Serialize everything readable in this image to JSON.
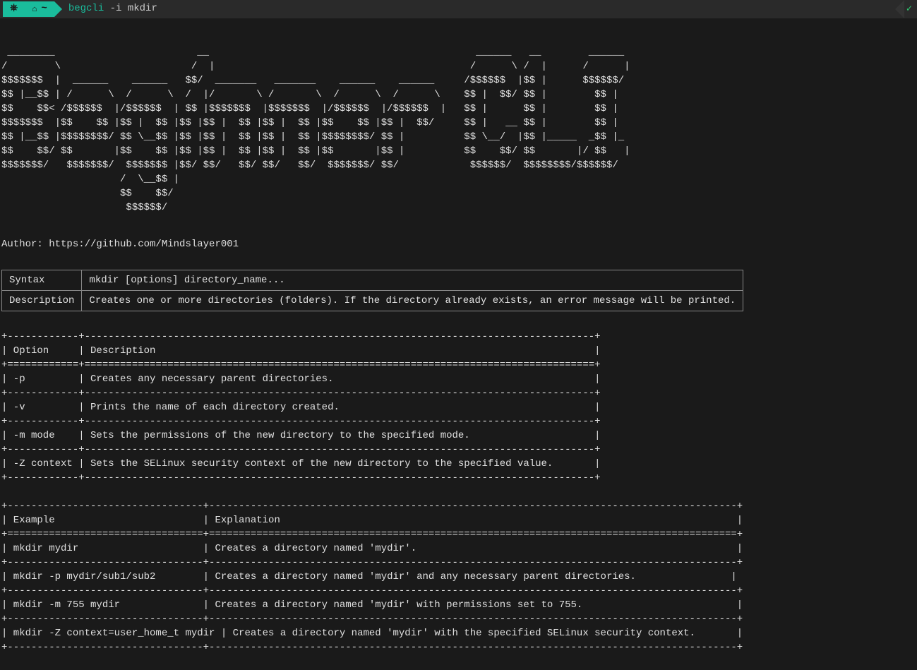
{
  "titlebar": {
    "logo": "⎈",
    "home_icon": "⌂",
    "tilde": "~",
    "cmd_name": "begcli",
    "cmd_args": "-i mkdir",
    "status_check": "✓"
  },
  "ascii_art": " ________                        __                                             ______   __        ______\n/        \\                      /  |                                           /      \\ /  |      /      |\n$$$$$$$  |  ______    ______   $$/  _______   _______    ______    ______     /$$$$$$  |$$ |      $$$$$$/\n$$ |__$$ | /      \\  /      \\  /  |/       \\ /       \\  /      \\  /      \\    $$ |  $$/ $$ |        $$ |\n$$    $$< /$$$$$$  |/$$$$$$  | $$ |$$$$$$$  |$$$$$$$  |/$$$$$$  |/$$$$$$  |   $$ |      $$ |        $$ |\n$$$$$$$  |$$    $$ |$$ |  $$ |$$ |$$ |  $$ |$$ |  $$ |$$    $$ |$$ |  $$/     $$ |   __ $$ |        $$ |\n$$ |__$$ |$$$$$$$$/ $$ \\__$$ |$$ |$$ |  $$ |$$ |  $$ |$$$$$$$$/ $$ |          $$ \\__/  |$$ |_____  _$$ |_\n$$    $$/ $$       |$$    $$ |$$ |$$ |  $$ |$$ |  $$ |$$       |$$ |          $$    $$/ $$       |/ $$   |\n$$$$$$$/   $$$$$$$/  $$$$$$$ |$$/ $$/   $$/ $$/   $$/  $$$$$$$/ $$/            $$$$$$/  $$$$$$$$/$$$$$$/\n                    /  \\__$$ |\n                    $$    $$/\n                     $$$$$$/",
  "author_line": "Author: https://github.com/Mindslayer001",
  "syntax_table": {
    "rows": [
      {
        "label": "Syntax",
        "value": "mkdir [options] directory_name..."
      },
      {
        "label": "Description",
        "value": "Creates one or more directories (folders). If the directory already exists, an error message will be printed."
      }
    ]
  },
  "options_table_text": "+------------+--------------------------------------------------------------------------------------+\n| Option     | Description                                                                          |\n+============+======================================================================================+\n| -p         | Creates any necessary parent directories.                                            |\n+------------+--------------------------------------------------------------------------------------+\n| -v         | Prints the name of each directory created.                                           |\n+------------+--------------------------------------------------------------------------------------+\n| -m mode    | Sets the permissions of the new directory to the specified mode.                     |\n+------------+--------------------------------------------------------------------------------------+\n| -Z context | Sets the SELinux security context of the new directory to the specified value.       |\n+------------+--------------------------------------------------------------------------------------+",
  "examples_table_text": "+---------------------------------+-----------------------------------------------------------------------------------------+\n| Example                         | Explanation                                                                             |\n+=================================+=========================================================================================+\n| mkdir mydir                     | Creates a directory named 'mydir'.                                                      |\n+---------------------------------+-----------------------------------------------------------------------------------------+\n| mkdir -p mydir/sub1/sub2        | Creates a directory named 'mydir' and any necessary parent directories.                |\n+---------------------------------+-----------------------------------------------------------------------------------------+\n| mkdir -m 755 mydir              | Creates a directory named 'mydir' with permissions set to 755.                          |\n+---------------------------------+-----------------------------------------------------------------------------------------+\n| mkdir -Z context=user_home_t mydir | Creates a directory named 'mydir' with the specified SELinux security context.       |\n+---------------------------------+-----------------------------------------------------------------------------------------+"
}
